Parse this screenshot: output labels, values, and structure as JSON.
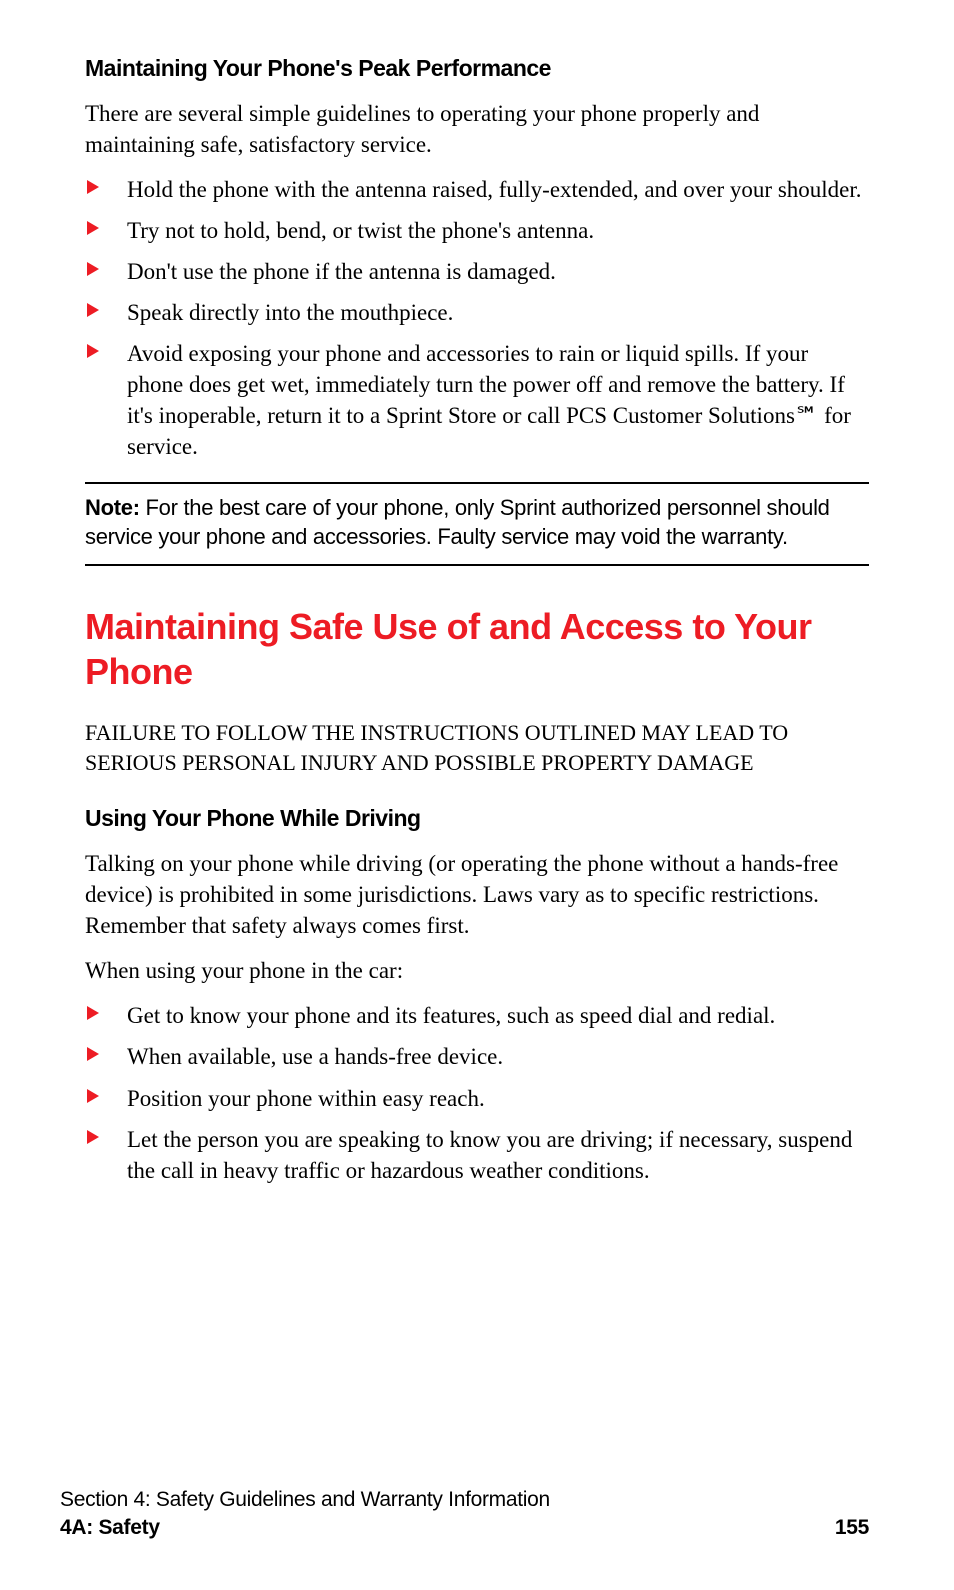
{
  "section1": {
    "heading": "Maintaining Your Phone's Peak Performance",
    "intro": "There are several simple guidelines to operating your phone properly and maintaining safe, satisfactory service.",
    "bullets": [
      "Hold the phone with the antenna raised, fully-extended, and over your shoulder.",
      "Try not to hold, bend, or twist the phone's antenna.",
      "Don't use the phone if the antenna is damaged.",
      "Speak directly into the mouthpiece.",
      "Avoid exposing your phone and accessories to rain or liquid spills. If your phone does get wet, immediately turn the power off and remove the battery. If it's inoperable, return it to a Sprint Store or call PCS Customer Solutions℠ for service."
    ]
  },
  "note": {
    "label": "Note:",
    "text": " For the best care of your phone, only Sprint authorized personnel should service your phone and accessories. Faulty service may void the warranty."
  },
  "section2": {
    "title": "Maintaining Safe Use of and Access to Your Phone",
    "warning": "FAILURE TO FOLLOW THE INSTRUCTIONS OUTLINED MAY LEAD TO SERIOUS PERSONAL INJURY AND POSSIBLE PROPERTY DAMAGE",
    "subhead": "Using Your Phone While Driving",
    "para1": "Talking on your phone while driving (or operating the phone without a hands-free device) is prohibited in some jurisdictions. Laws vary as to specific restrictions. Remember that safety always comes first.",
    "para2": "When using your phone in the car:",
    "bullets": [
      "Get to know your phone and its features, such as speed dial and redial.",
      "When available, use a hands-free device.",
      "Position your phone within easy reach.",
      "Let the person you are speaking to know you are driving; if necessary, suspend the call in heavy traffic or hazardous weather conditions."
    ]
  },
  "footer": {
    "section_line": "Section 4: Safety Guidelines and Warranty Information",
    "chapter": "4A: Safety",
    "page": "155"
  }
}
